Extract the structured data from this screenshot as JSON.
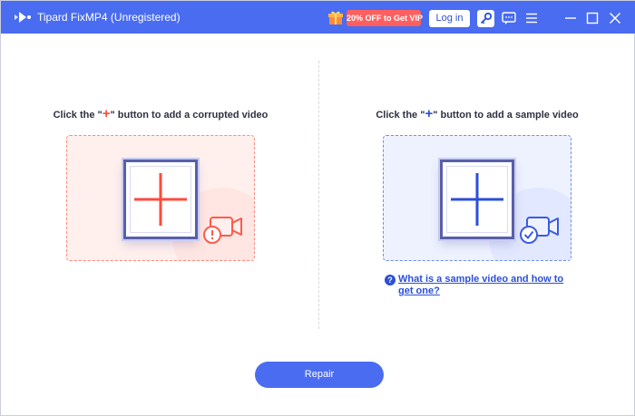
{
  "window": {
    "title": "Tipard FixMP4 (Unregistered)",
    "promo_label": "20% OFF to Get VIP",
    "login_label": "Log in",
    "icons": [
      "app-logo-icon",
      "gift-icon",
      "key-icon",
      "feedback-icon",
      "menu-icon",
      "minimize-icon",
      "maximize-icon",
      "close-icon"
    ]
  },
  "colors": {
    "accent": "#4a6cf0",
    "promo": "#ff5f5f",
    "corrupted": "#ff4a3d",
    "sample": "#2b4fd8"
  },
  "left_panel": {
    "instruction_prefix": "Click the \"",
    "instruction_plus": "+",
    "instruction_suffix": "\" button to add a corrupted video",
    "icon": "video-warning-icon"
  },
  "right_panel": {
    "instruction_prefix": "Click the \"",
    "instruction_plus": "+",
    "instruction_suffix": "\" button to add a sample video",
    "icon": "video-check-icon",
    "help_link": "What is a sample video and how to get one?"
  },
  "repair_label": "Repair"
}
